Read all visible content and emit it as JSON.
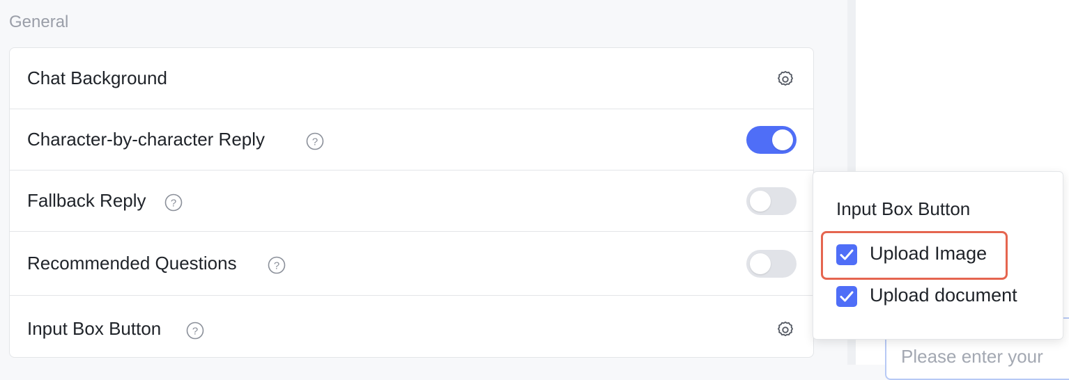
{
  "section_title": "General",
  "settings": {
    "chat_background": {
      "label": "Chat Background",
      "icon": "gear-icon"
    },
    "char_reply": {
      "label": "Character-by-character Reply",
      "icon": "help-icon",
      "enabled": true
    },
    "fallback_reply": {
      "label": "Fallback Reply",
      "icon": "help-icon",
      "enabled": false
    },
    "recommended_questions": {
      "label": "Recommended Questions",
      "icon": "help-icon",
      "enabled": false
    },
    "input_box_button": {
      "label": "Input Box Button",
      "icon": "help-icon",
      "settings_icon": "gear-icon"
    }
  },
  "popover": {
    "title": "Input Box Button",
    "options": [
      {
        "label": "Upload Image",
        "checked": true,
        "highlighted": true
      },
      {
        "label": "Upload document",
        "checked": true
      }
    ]
  },
  "chat_input": {
    "placeholder": "Please enter your"
  },
  "colors": {
    "accent": "#4f6ef7",
    "toggle_off": "#e1e3e8",
    "highlight": "#e5654f",
    "muted_text": "#9a9ea8"
  }
}
